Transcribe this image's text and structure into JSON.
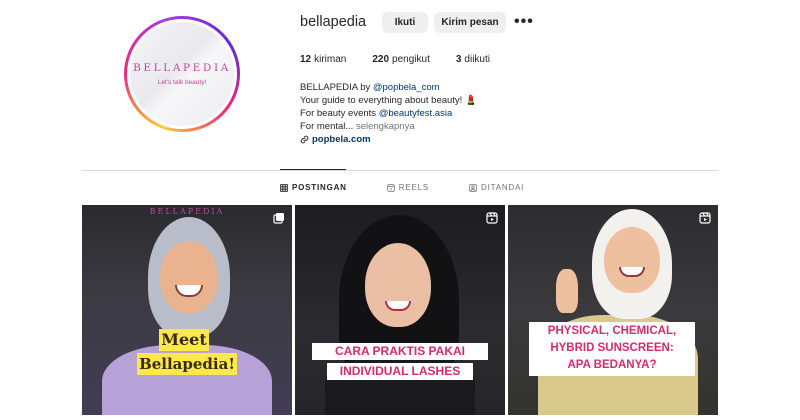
{
  "profile": {
    "username": "bellapedia",
    "avatar_brand": "BELLAPEDIA",
    "avatar_tagline": "Let's talk beauty!",
    "follow_label": "Ikuti",
    "message_label": "Kirim pesan",
    "more_label": "•••"
  },
  "stats": {
    "posts_count": "12",
    "posts_label": "kiriman",
    "followers_count": "220",
    "followers_label": "pengikut",
    "following_count": "3",
    "following_label": "diikuti"
  },
  "bio": {
    "line1_prefix": "BELLAPEDIA by ",
    "line1_mention": "@popbela_com",
    "line2": "Your guide to everything about beauty! 💄",
    "line3_prefix": "For beauty events ",
    "line3_mention": "@beautyfest.asia",
    "line4_prefix": "For mental... ",
    "line4_more": "selengkapnya",
    "link": "popbela.com"
  },
  "tabs": [
    {
      "label": "POSTINGAN",
      "icon": "grid-icon",
      "active": true
    },
    {
      "label": "REELS",
      "icon": "reels-icon",
      "active": false
    },
    {
      "label": "DITANDAI",
      "icon": "tagged-icon",
      "active": false
    }
  ],
  "posts": [
    {
      "type_icon": "carousel-icon",
      "watermark": "BELLAPEDIA",
      "caption_line1": "Meet",
      "caption_line2": "Bellapedia!"
    },
    {
      "type_icon": "reel-icon",
      "caption_line1": "CARA PRAKTIS PAKAI",
      "caption_line2": "INDIVIDUAL LASHES"
    },
    {
      "type_icon": "reel-icon",
      "caption_line1": "PHYSICAL, CHEMICAL,",
      "caption_line2": "HYBRID SUNSCREEN:",
      "caption_line3": "APA BEDANYA?"
    }
  ],
  "colors": {
    "text": "#262626",
    "secondary": "#737373",
    "link": "#00376b",
    "button_bg": "#efefef",
    "brand_pink": "#c0479a",
    "caption_pink": "#d42b6e",
    "caption_yellow": "#fde84a"
  }
}
